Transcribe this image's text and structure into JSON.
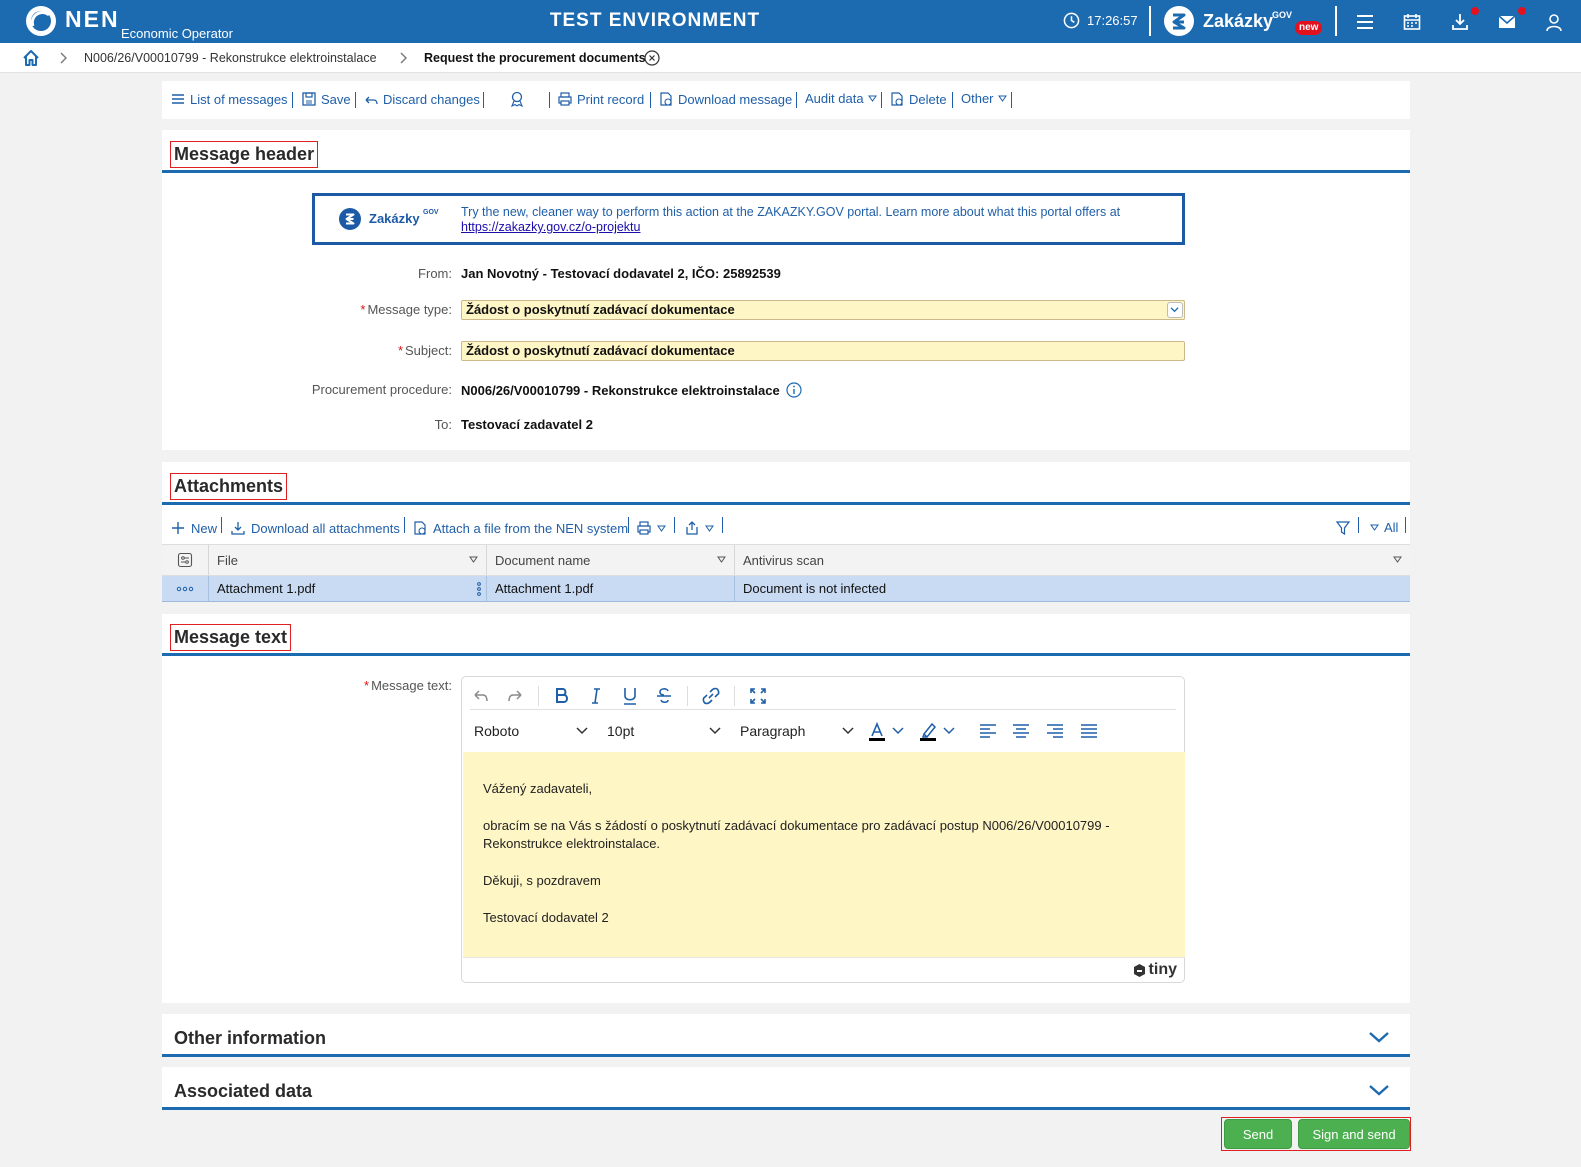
{
  "topbar": {
    "brand": "NEN",
    "brand_sub": "Economic Operator",
    "environment": "TEST ENVIRONMENT",
    "time": "17:26:57",
    "portal_name": "Zakázky",
    "portal_sup": "GOV",
    "portal_badge": "new"
  },
  "breadcrumb": {
    "items": [
      "N006/26/V00010799 - Rekonstrukce elektroinstalace",
      "Request the procurement documents"
    ]
  },
  "toolbar": {
    "list_of_messages": "List of messages",
    "save": "Save",
    "discard_changes": "Discard changes",
    "print_record": "Print record",
    "download_message": "Download message",
    "audit_data": "Audit data",
    "delete": "Delete",
    "other": "Other"
  },
  "message_header": {
    "title": "Message header",
    "banner": {
      "brand": "Zakázky",
      "brand_sup": "GOV",
      "text": "Try the new, cleaner way to perform this action at the ZAKAZKY.GOV portal. Learn more about what this portal offers at",
      "link": "https://zakazky.gov.cz/o-projektu"
    },
    "from_label": "From:",
    "from_value": "Jan Novotný - Testovací dodavatel 2, IČO: 25892539",
    "message_type_label": "Message type:",
    "message_type_value": "Žádost o poskytnutí zadávací dokumentace",
    "subject_label": "Subject:",
    "subject_value": "Žádost o poskytnutí zadávací dokumentace",
    "procedure_label": "Procurement procedure:",
    "procedure_value": "N006/26/V00010799 - Rekonstrukce elektroinstalace",
    "to_label": "To:",
    "to_value": "Testovací zadavatel 2"
  },
  "attachments": {
    "title": "Attachments",
    "new": "New",
    "download_all": "Download all attachments",
    "attach_from_nen": "Attach a file from the NEN system",
    "filter_all": "All",
    "columns": [
      "File",
      "Document name",
      "Antivirus scan"
    ],
    "rows": [
      {
        "file": "Attachment 1.pdf",
        "document_name": "Attachment 1.pdf",
        "antivirus": "Document is not infected"
      }
    ]
  },
  "message_text": {
    "title": "Message text",
    "label": "Message text:",
    "editor": {
      "font": "Roboto",
      "size": "10pt",
      "block": "Paragraph",
      "brand": "tiny",
      "paragraphs": [
        "Vážený zadavateli,",
        "obracím se na Vás s žádostí o poskytnutí zadávací dokumentace pro zadávací postup N006/26/V00010799 - Rekonstrukce elektroinstalace.",
        "Děkuji, s pozdravem",
        "Testovací dodavatel 2"
      ]
    }
  },
  "other_information": {
    "title": "Other information"
  },
  "associated_data": {
    "title": "Associated data"
  },
  "actions": {
    "send": "Send",
    "sign_and_send": "Sign and send"
  },
  "colors": {
    "primary": "#1c6bb1",
    "field_bg": "#fff6c5",
    "selected_row": "#c9dbf3",
    "button": "#4caf50",
    "alert": "#e3101e"
  }
}
